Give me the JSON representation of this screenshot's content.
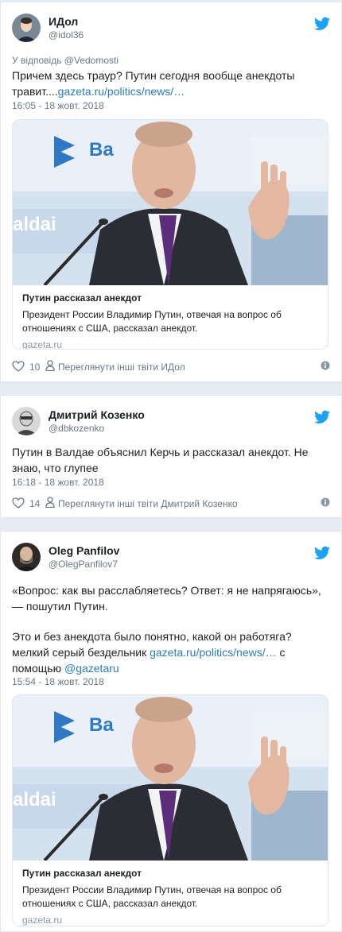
{
  "tweets": [
    {
      "name": "ИДол",
      "handle": "@idol36",
      "reply_to": "У відповідь @Vedomosti",
      "text": "Причем здесь траур? Путин сегодня вообще анекдоты травит....",
      "link": "gazeta.ru/politics/news/…",
      "time": "16:05 - 18 жовт. 2018",
      "card": {
        "title": "Путин рассказал анекдот",
        "desc": "Президент России Владимир Путин, отвечая на вопрос об отношениях с США, рассказал анекдот.",
        "domain": "gazeta.ru"
      },
      "likes": "10",
      "more": "Переглянути інші твіти ИДол"
    },
    {
      "name": "Дмитрий Козенко",
      "handle": "@dbkozenko",
      "text": "Путин в Валдае объяснил Керчь и рассказал анекдот. Не знаю, что глупее",
      "time": "16:18 - 18 жовт. 2018",
      "likes": "14",
      "more": "Переглянути інші твіти Дмитрий Козенко"
    },
    {
      "name": "Oleg Panfilov",
      "handle": "@OlegPanfilov7",
      "text_p1": "«Вопрос: как вы расслабляетесь? Ответ: я не напрягаюсь», — пошутил Путин.",
      "text_p2_pre": "Это и без анекдота было понятно, какой он работяга? мелкий серый бездельник ",
      "link": "gazeta.ru/politics/news/…",
      "text_p2_mid": " с помощью ",
      "mention": "@gazetaru",
      "time": "15:54 - 18 жовт. 2018",
      "card": {
        "title": "Путин рассказал анекдот",
        "desc": "Президент России Владимир Путин, отвечая на вопрос об отношениях с США, рассказал анекдот.",
        "domain": "gazeta.ru"
      }
    }
  ],
  "card_image": {
    "banner_text_1": "Ва",
    "banner_text_2": "aldai"
  },
  "colors": {
    "twitter_blue": "#1da1f2",
    "link": "#2b7bb9",
    "meta": "#697882",
    "border": "#e1e8ed"
  }
}
